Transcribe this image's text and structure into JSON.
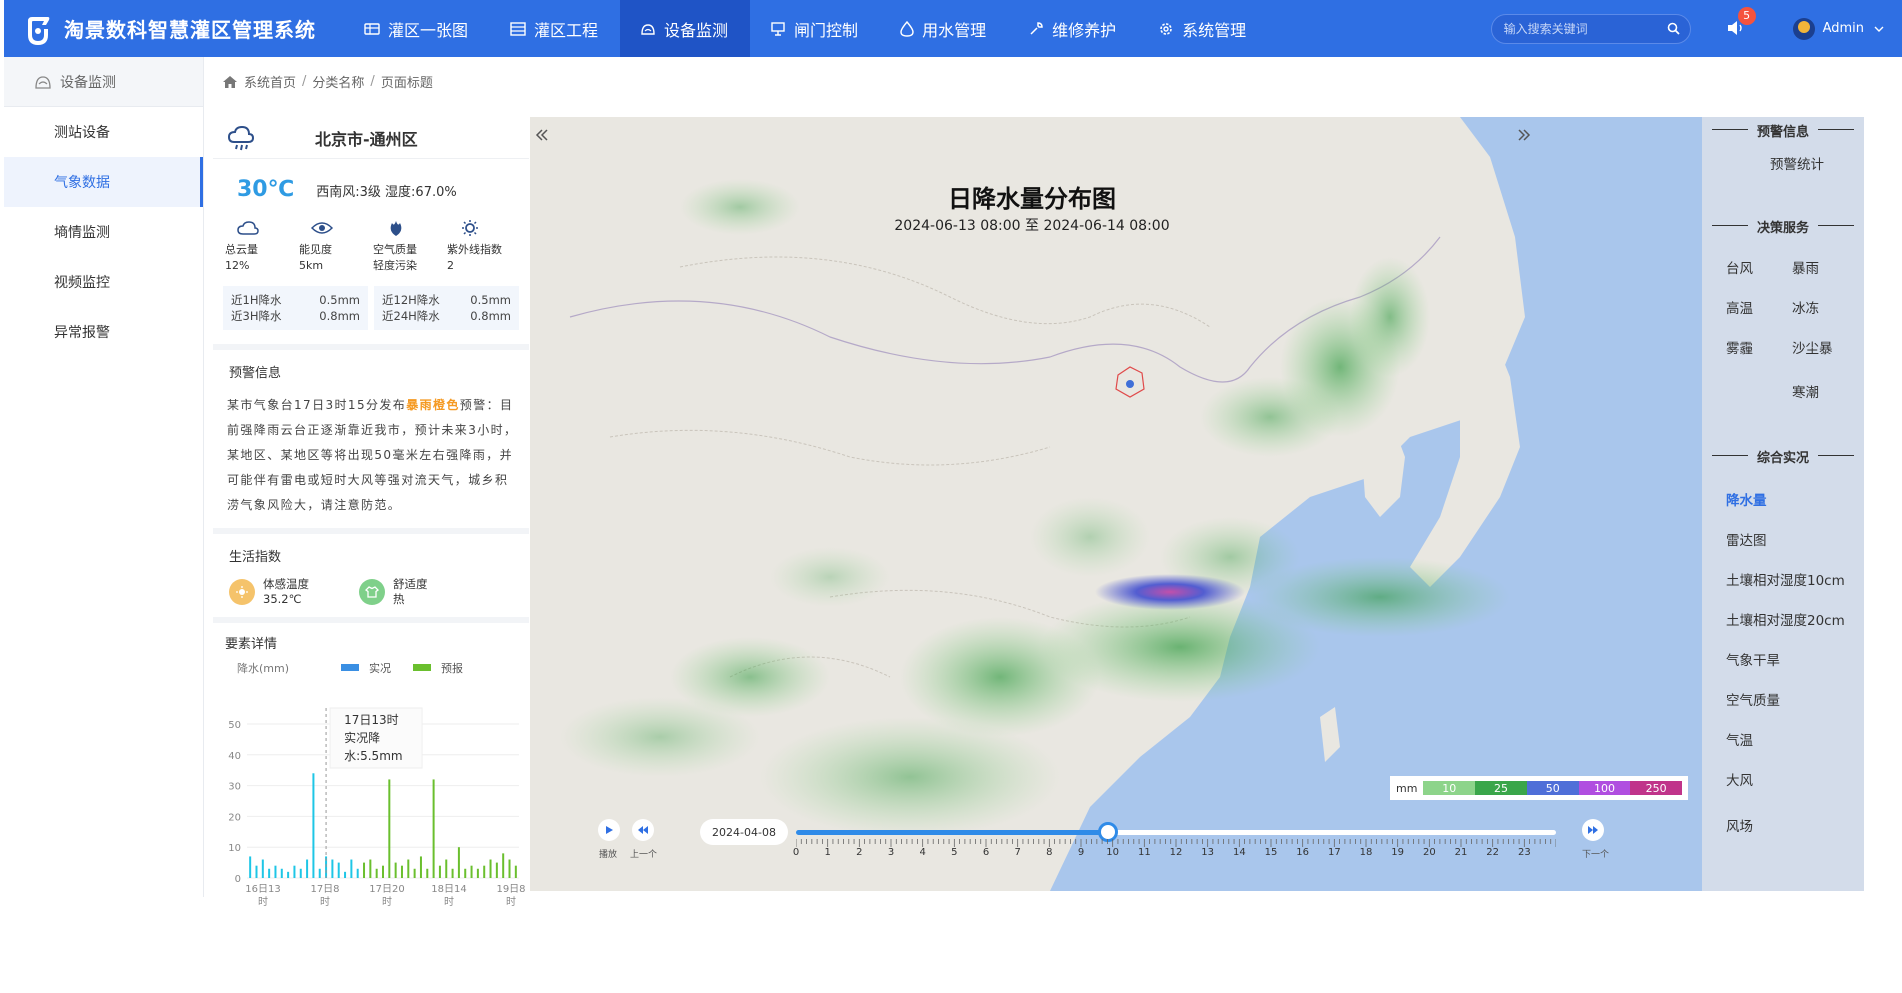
{
  "app": {
    "title": "淘景数科智慧灌区管理系统"
  },
  "nav": {
    "items": [
      {
        "label": "灌区一张图",
        "icon": "map-icon"
      },
      {
        "label": "灌区工程",
        "icon": "building-icon"
      },
      {
        "label": "设备监测",
        "icon": "monitor-icon",
        "active": true
      },
      {
        "label": "闸门控制",
        "icon": "gate-icon"
      },
      {
        "label": "用水管理",
        "icon": "water-drop-icon"
      },
      {
        "label": "维修养护",
        "icon": "wrench-icon"
      },
      {
        "label": "系统管理",
        "icon": "gear-icon"
      }
    ]
  },
  "header": {
    "search_placeholder": "输入搜索关键词",
    "notification_count": "5",
    "user_name": "Admin"
  },
  "sidebar": {
    "title": "设备监测",
    "items": [
      {
        "label": "测站设备"
      },
      {
        "label": "气象数据",
        "active": true
      },
      {
        "label": "墒情监测"
      },
      {
        "label": "视频监控"
      },
      {
        "label": "异常报警"
      }
    ]
  },
  "breadcrumb": {
    "home": "系统首页",
    "sep1": "/",
    "category": "分类名称",
    "sep2": "/",
    "page": "页面标题"
  },
  "weather": {
    "location": "北京市-通州区",
    "temperature": "30℃",
    "wind_humidity": "西南风:3级 湿度:67.0%",
    "stats": [
      {
        "label": "总云量",
        "value": "12%",
        "icon": "cloud-icon"
      },
      {
        "label": "能见度",
        "value": "5km",
        "icon": "eye-icon"
      },
      {
        "label": "空气质量",
        "value": "轻度污染",
        "icon": "leaf-icon"
      },
      {
        "label": "紫外线指数",
        "value": "2",
        "icon": "sun-icon"
      }
    ],
    "rain": [
      {
        "label": "近1H降水",
        "value": "0.5mm"
      },
      {
        "label": "近3H降水",
        "value": "0.8mm"
      },
      {
        "label": "近12H降水",
        "value": "0.5mm"
      },
      {
        "label": "近24H降水",
        "value": "0.8mm"
      }
    ],
    "warning_title": "预警信息",
    "warning_part1": "某市气象台17日3时15分发布",
    "warning_highlight": "暴雨橙色",
    "warning_part2": "预警：目前强降雨云台正逐渐靠近我市，预计未来3小时，某地区、某地区等将出现50毫米左右强降雨，并可能伴有雷电或短时大风等强对流天气，城乡积涝气象风险大，请注意防范。",
    "life_title": "生活指数",
    "life": [
      {
        "label": "体感温度",
        "value": "35.2℃",
        "icon": "thermometer-icon",
        "color": "#f5c36b"
      },
      {
        "label": "舒适度",
        "value": "热",
        "icon": "shirt-icon",
        "color": "#7fd08a"
      }
    ],
    "detail_title": "要素详情"
  },
  "chart_data": {
    "type": "bar",
    "ylabel": "降水(mm)",
    "ylim": [
      0,
      50
    ],
    "yticks": [
      0,
      10,
      20,
      30,
      40,
      50
    ],
    "xticks": [
      "16日13时",
      "17日8时",
      "17日20时",
      "18日14时",
      "19日8时"
    ],
    "series": [
      {
        "name": "实况",
        "color": "#1ec6e6",
        "values": [
          7,
          4,
          6,
          3,
          4,
          3,
          2,
          4,
          3,
          6,
          34,
          3,
          7,
          6,
          5,
          2,
          6,
          3,
          0,
          0,
          0,
          0,
          0,
          0,
          0,
          0,
          0,
          0,
          0,
          0,
          0,
          0,
          0,
          0,
          0,
          0,
          0,
          0,
          0,
          0,
          0,
          0,
          0
        ]
      },
      {
        "name": "预报",
        "color": "#6abf2e",
        "values": [
          0,
          0,
          0,
          0,
          0,
          0,
          0,
          0,
          0,
          0,
          0,
          0,
          0,
          0,
          0,
          0,
          0,
          0,
          5,
          6,
          3,
          4,
          32,
          5,
          4,
          6,
          3,
          7,
          3,
          32,
          4,
          6,
          3,
          10,
          3,
          4,
          3,
          4,
          6,
          5,
          8,
          6,
          4
        ]
      }
    ],
    "tooltip": {
      "line1": "17日13时",
      "line2": "实况降",
      "line3": "水:5.5mm"
    }
  },
  "map": {
    "title": "日降水量分布图",
    "subtitle": "2024-06-13 08:00 至 2024-06-14 08:00",
    "legend": {
      "unit": "mm",
      "ticks": [
        "10",
        "25",
        "50",
        "100",
        "250"
      ],
      "colors": [
        "#8dd48a",
        "#3aa64a",
        "#4f6fd8",
        "#b04ee0",
        "#c0348a"
      ]
    },
    "timeline": {
      "date": "2024-04-08",
      "play_label": "播放",
      "prev_label": "上一个",
      "next_label": "下一个",
      "hours": [
        "0",
        "1",
        "2",
        "3",
        "4",
        "5",
        "6",
        "7",
        "8",
        "9",
        "10",
        "11",
        "12",
        "13",
        "14",
        "15",
        "16",
        "17",
        "18",
        "19",
        "20",
        "21",
        "22",
        "23"
      ],
      "progress": 0.41
    }
  },
  "right": {
    "warn_title": "预警信息",
    "warn_items": [
      "预警统计"
    ],
    "decision_title": "决策服务",
    "decision_items": [
      "台风",
      "暴雨",
      "高温",
      "冰冻",
      "雾霾",
      "沙尘暴",
      "寒潮"
    ],
    "live_title": "综合实况",
    "live_items": [
      "降水量",
      "雷达图",
      "土壤相对湿度10cm",
      "土壤相对湿度20cm",
      "气象干旱",
      "空气质量",
      "气温",
      "大风",
      "风场"
    ]
  }
}
